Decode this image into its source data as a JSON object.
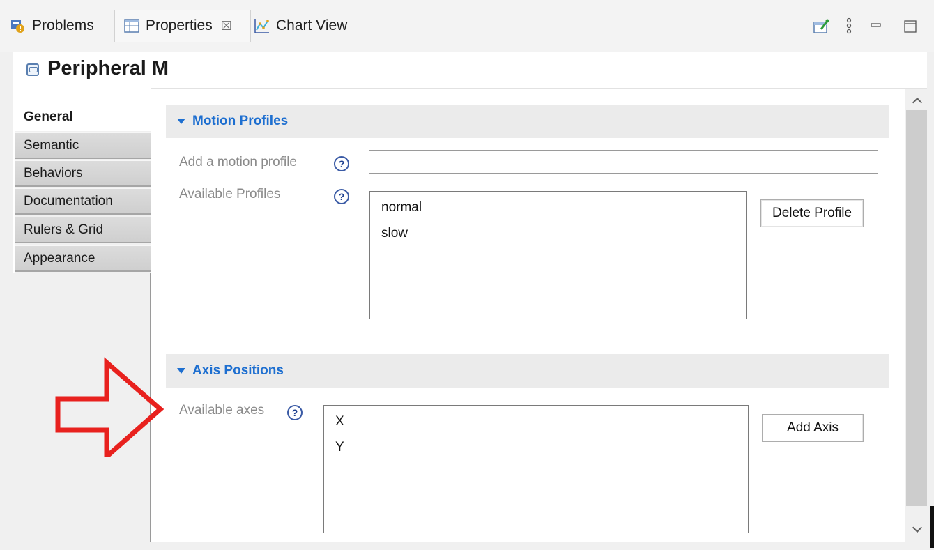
{
  "tabs": {
    "problems_label": "Problems",
    "properties_label": "Properties",
    "properties_close": "☒",
    "chart_label": "Chart View"
  },
  "header": {
    "title": "Peripheral M"
  },
  "sidebar": {
    "items": [
      {
        "label": "General",
        "active": true
      },
      {
        "label": "Semantic"
      },
      {
        "label": "Behaviors"
      },
      {
        "label": "Documentation"
      },
      {
        "label": "Rulers & Grid"
      },
      {
        "label": "Appearance"
      }
    ]
  },
  "motion": {
    "section_title": "Motion Profiles",
    "add_label": "Add a motion profile",
    "add_value": "",
    "available_label": "Available Profiles",
    "profiles": [
      "normal",
      "slow"
    ],
    "delete_button": "Delete Profile",
    "help_glyph": "?"
  },
  "axes": {
    "section_title": "Axis Positions",
    "available_label": "Available axes",
    "axes_list": [
      "X",
      "Y"
    ],
    "add_button": "Add Axis",
    "help_glyph": "?"
  },
  "colors": {
    "section_text": "#1e6fd0",
    "annotation_arrow": "#e8211e"
  }
}
